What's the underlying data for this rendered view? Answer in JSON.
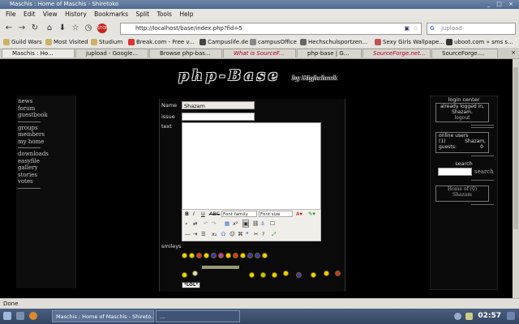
{
  "window": {
    "title": "Maschis : Home of Maschis - Shiretoko",
    "controls": "_ □ ×"
  },
  "menu": [
    "File",
    "Edit",
    "View",
    "History",
    "Bookmarks",
    "Split",
    "Tools",
    "Help"
  ],
  "nav": {
    "url": "http://localhost/base/index.php?fid=5",
    "search_placeholder": "jupload"
  },
  "bookmarks": [
    "Guild Wars",
    "Most Visited",
    "Studium",
    "Break.com - Free v...",
    "Campuslife.de",
    "campusOffice",
    "Hechschulsportzen...",
    "Sexy Girls Wallpape...",
    "uboot.com » sms s..."
  ],
  "tabs": [
    "Maschis : Ho...",
    "jupload - Google...",
    "Browse php-bas...",
    "What is SourceF...",
    "php-base | G...",
    "SourceForge.net...",
    "SourceForge...."
  ],
  "site": {
    "logo": "php-Base",
    "byline": "by Highcheek",
    "nav": [
      "news",
      "forum",
      "guestbook",
      "groups",
      "members",
      "my home",
      "downloads",
      "easyfile",
      "gallery",
      "stories",
      "votes"
    ],
    "form": {
      "name_label": "Name",
      "name_value": "Shazam",
      "issue_label": "issue",
      "text_label": "text",
      "font_family": "Font family",
      "font_size": "Font size",
      "smileys_label": "smileys",
      "lol": "*LOL*"
    },
    "login": {
      "title": "login center",
      "logged_in": "already logged in,",
      "user": "Shazam.",
      "logout": "logout"
    },
    "online": {
      "label": "online users",
      "count": "(1)",
      "user": "Shazam,",
      "guests_label": "guests:",
      "guests": "0"
    },
    "search": {
      "title": "search",
      "button": "search"
    },
    "home": {
      "line1": "Home of (0)",
      "line2": "Shazam"
    }
  },
  "status": "Done",
  "taskbar": {
    "items": [
      "Maschis : Home of Maschis - Shireto...",
      "..."
    ],
    "clock": "02:57"
  }
}
